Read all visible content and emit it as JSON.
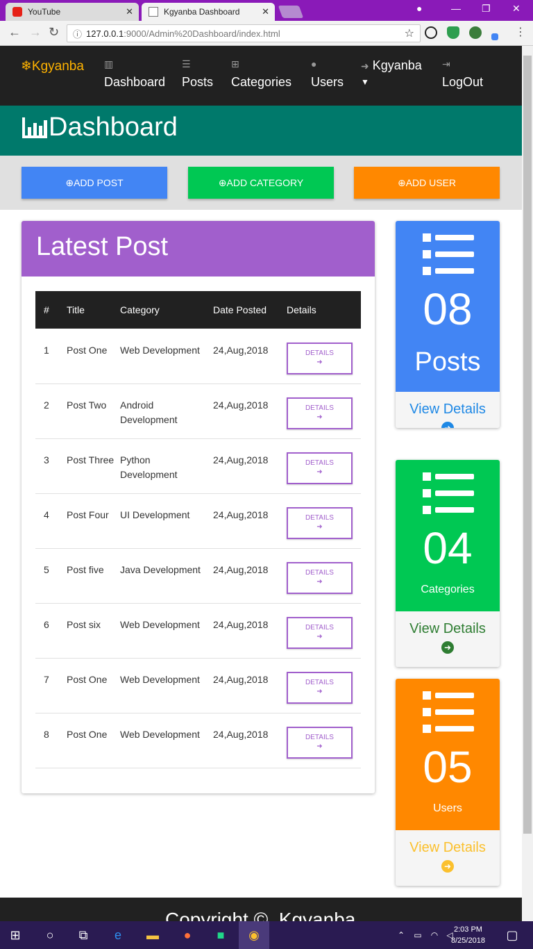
{
  "browser": {
    "tabs": [
      {
        "title": "YouTube",
        "favicon": "youtube-icon"
      },
      {
        "title": "Kgyanba Dashboard",
        "favicon": "page-icon"
      }
    ],
    "url_host": "127.0.0.1",
    "url_path": ":9000/Admin%20Dashboard/index.html"
  },
  "nav": {
    "brand": "❄Kgyanba",
    "items": [
      {
        "label": "Dashboard",
        "icon": "bar-chart-icon"
      },
      {
        "label": "Posts",
        "icon": "list-icon"
      },
      {
        "label": "Categories",
        "icon": "sitemap-icon"
      },
      {
        "label": "Users",
        "icon": "user-icon"
      },
      {
        "label": "Kgyanba",
        "icon": "sign-in-icon"
      },
      {
        "label": "LogOut",
        "icon": "sign-out-icon"
      }
    ]
  },
  "hero": {
    "title": "Dashboard"
  },
  "actions": [
    {
      "label": "ADD POST",
      "color": "#4285f4"
    },
    {
      "label": "ADD CATEGORY",
      "color": "#00c853"
    },
    {
      "label": "ADD USER",
      "color": "#ff8800"
    }
  ],
  "latest": {
    "title": "Latest Post",
    "columns": [
      "#",
      "Title",
      "Category",
      "Date Posted",
      "Details"
    ],
    "details_label": "DETAILS",
    "rows": [
      {
        "num": "1",
        "title": "Post One",
        "category": "Web Development",
        "date": "24,Aug,2018"
      },
      {
        "num": "2",
        "title": "Post Two",
        "category": "Android Development",
        "date": "24,Aug,2018"
      },
      {
        "num": "3",
        "title": "Post Three",
        "category": "Python Development",
        "date": "24,Aug,2018"
      },
      {
        "num": "4",
        "title": "Post Four",
        "category": "UI Development",
        "date": "24,Aug,2018"
      },
      {
        "num": "5",
        "title": "Post five",
        "category": "Java Development",
        "date": "24,Aug,2018"
      },
      {
        "num": "6",
        "title": "Post six",
        "category": "Web Development",
        "date": "24,Aug,2018"
      },
      {
        "num": "7",
        "title": "Post One",
        "category": "Web Development",
        "date": "24,Aug,2018"
      },
      {
        "num": "8",
        "title": "Post One",
        "category": "Web Development",
        "date": "24,Aug,2018"
      }
    ]
  },
  "cards": [
    {
      "count": "08",
      "label": "Posts",
      "link": "View Details",
      "color": "#4285f4"
    },
    {
      "count": "04",
      "label": "Categories",
      "link": "View Details",
      "color": "#00c853"
    },
    {
      "count": "05",
      "label": "Users",
      "link": "View Details",
      "color": "#ff8800"
    }
  ],
  "footer": {
    "text": "Copyright ©. Kgyanba"
  },
  "taskbar": {
    "time": "2:03 PM",
    "date": "8/25/2018"
  }
}
